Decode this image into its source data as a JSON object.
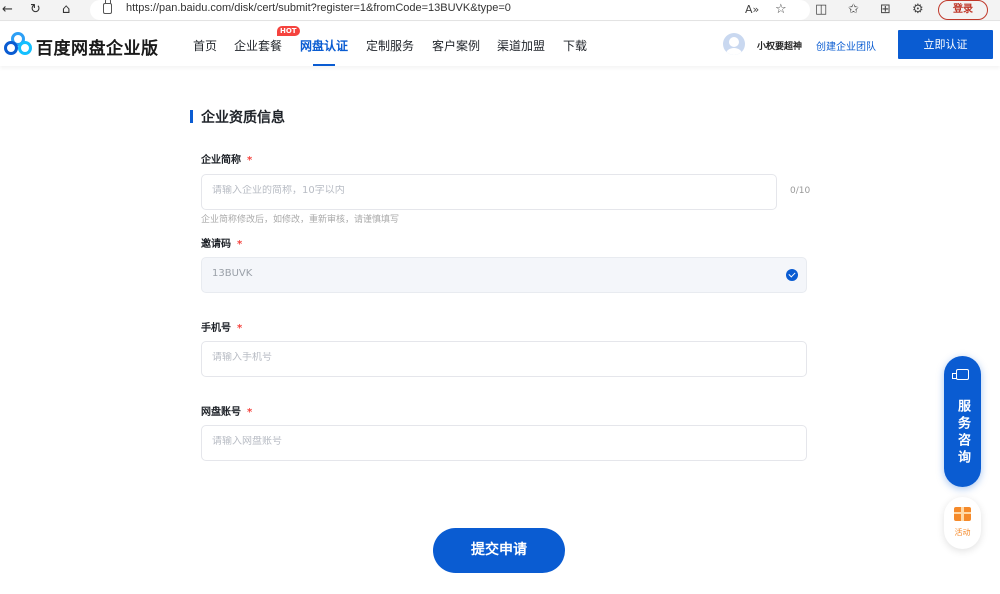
{
  "browser": {
    "url": "https://pan.baidu.com/disk/cert/submit?register=1&fromCode=13BUVK&type=0",
    "nav_icons": [
      "back-icon",
      "refresh-icon",
      "home-icon"
    ],
    "toolbar_icons": [
      "read-aloud-icon",
      "favorite-star-icon",
      "split-screen-icon",
      "favorites-icon",
      "collections-icon",
      "extensions-icon"
    ],
    "login_label": "登录"
  },
  "header": {
    "brand": "百度网盘企业版",
    "nav": [
      {
        "label": "首页"
      },
      {
        "label": "企业套餐",
        "badge": "HOT"
      },
      {
        "label": "网盘认证",
        "active": true
      },
      {
        "label": "定制服务"
      },
      {
        "label": "客户案例"
      },
      {
        "label": "渠道加盟"
      },
      {
        "label": "下载"
      }
    ],
    "username": "小权要超神",
    "create_team": "创建企业团队",
    "cert_button": "立即认证"
  },
  "form": {
    "section_title": "企业资质信息",
    "fields": [
      {
        "label": "企业简称",
        "required": "*",
        "placeholder": "请输入企业的简称，10字以内",
        "counter": "0/10",
        "hint": "企业简称修改后，如修改，重新审核，请谨慎填写"
      },
      {
        "label": "邀请码",
        "required": "*",
        "value": "13BUVK",
        "verified": true
      },
      {
        "label": "手机号",
        "required": "*",
        "placeholder": "请输入手机号"
      },
      {
        "label": "网盘账号",
        "required": "*",
        "placeholder": "请输入网盘账号"
      }
    ],
    "submit": "提交申请"
  },
  "floating": {
    "service": "服务咨询",
    "activity": "活动"
  },
  "colors": {
    "primary": "#0a5cd2",
    "required": "#f5433e",
    "activity": "#f58a2a"
  }
}
